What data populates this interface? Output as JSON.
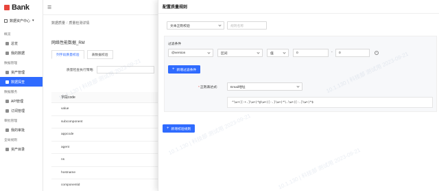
{
  "brand": {
    "logo_text": "Bank"
  },
  "sidebar": {
    "tenant": "数据资产中心",
    "groups": [
      {
        "label": "概览"
      },
      {
        "label": "数据管理"
      },
      {
        "label": "数据服务"
      },
      {
        "label": "审批管理"
      },
      {
        "label": "全局规则"
      }
    ],
    "items": [
      {
        "label": "总览"
      },
      {
        "label": "我的数据"
      },
      {
        "label": "资产管理"
      },
      {
        "label": "数据探查"
      },
      {
        "label": "API管理"
      },
      {
        "label": "订阅管理"
      },
      {
        "label": "我的审批"
      },
      {
        "label": "资产目录"
      }
    ],
    "accent": "#2f6bff"
  },
  "page": {
    "breadcrumb": [
      "数据质量",
      "质量检测详情"
    ],
    "title": "网络性能数据_RM",
    "tabs": [
      "列字段质量校验",
      "表数据校验"
    ],
    "field_label": "质量检查执行策略:",
    "table_header": "字段code",
    "rows": [
      "value",
      "subcomponent",
      "appcode",
      "agent",
      "ns",
      "hostname",
      "componentid"
    ]
  },
  "drawer": {
    "title": "配置质量规则",
    "rule_type": "文本正则校验",
    "rule_name_placeholder": "规则名称",
    "filter_label": "过滤条件",
    "filter": {
      "field": "@version",
      "operator": "区间",
      "value_type": "值",
      "min": "0",
      "max": "0"
    },
    "add_filter_label": "新增过滤条件",
    "regex_label": "正则表达式:",
    "regex_type": "Email地址",
    "regex_value": "^\\w+([-+.]\\w+)*@\\w+([-.]\\w+)*\\.\\w+([-.]\\w+)*$",
    "add_rule_label": "新增校验规则"
  },
  "watermark": "10.1.130 | 科技部 测试用 2023-09-21"
}
